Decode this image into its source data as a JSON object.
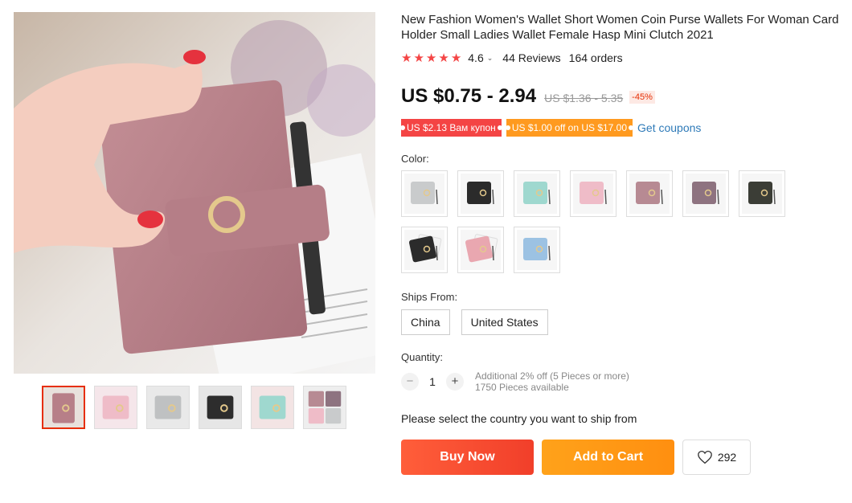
{
  "product": {
    "title": "New Fashion Women's Wallet Short Women Coin Purse Wallets For Woman Card Holder Small Ladies Wallet Female Hasp Mini Clutch 2021",
    "rating": "4.6",
    "reviews": "44 Reviews",
    "orders": "164 orders",
    "price": "US $0.75 - 2.94",
    "original_price": "US $1.36 - 5.35",
    "discount": "-45%"
  },
  "coupons": {
    "coupon1": "US $2.13 Вам купон",
    "coupon2": "US $1.00 off on US $17.00",
    "get_coupons": "Get coupons"
  },
  "color": {
    "label": "Color:",
    "swatches": [
      {
        "name": "gray",
        "color": "#c9cbcc"
      },
      {
        "name": "black",
        "color": "#2b2b2b"
      },
      {
        "name": "mint",
        "color": "#9fd8cf"
      },
      {
        "name": "light-pink",
        "color": "#efbcc8"
      },
      {
        "name": "mauve-pink",
        "color": "#b78a93"
      },
      {
        "name": "dusty-purple",
        "color": "#8e7380"
      },
      {
        "name": "dark-olive",
        "color": "#3b3d36"
      },
      {
        "name": "black-white",
        "color": "#2b2b2b"
      },
      {
        "name": "pink-white",
        "color": "#e9a7b0"
      },
      {
        "name": "light-blue",
        "color": "#9cc2e3"
      }
    ]
  },
  "ships_from": {
    "label": "Ships From:",
    "options": [
      "China",
      "United States"
    ]
  },
  "quantity": {
    "label": "Quantity:",
    "value": "1",
    "minus": "−",
    "plus": "+",
    "extra_discount": "Additional 2% off (5 Pieces or more)",
    "available": "1750 Pieces available"
  },
  "country_message": "Please select the country you want to ship from",
  "actions": {
    "buy_now": "Buy Now",
    "add_to_cart": "Add to Cart",
    "wishlist_count": "292"
  },
  "colors": {
    "accent_red": "#f13f2a",
    "accent_orange": "#ff9a1f",
    "link_blue": "#2e7ab8",
    "star_red": "#f44545"
  }
}
